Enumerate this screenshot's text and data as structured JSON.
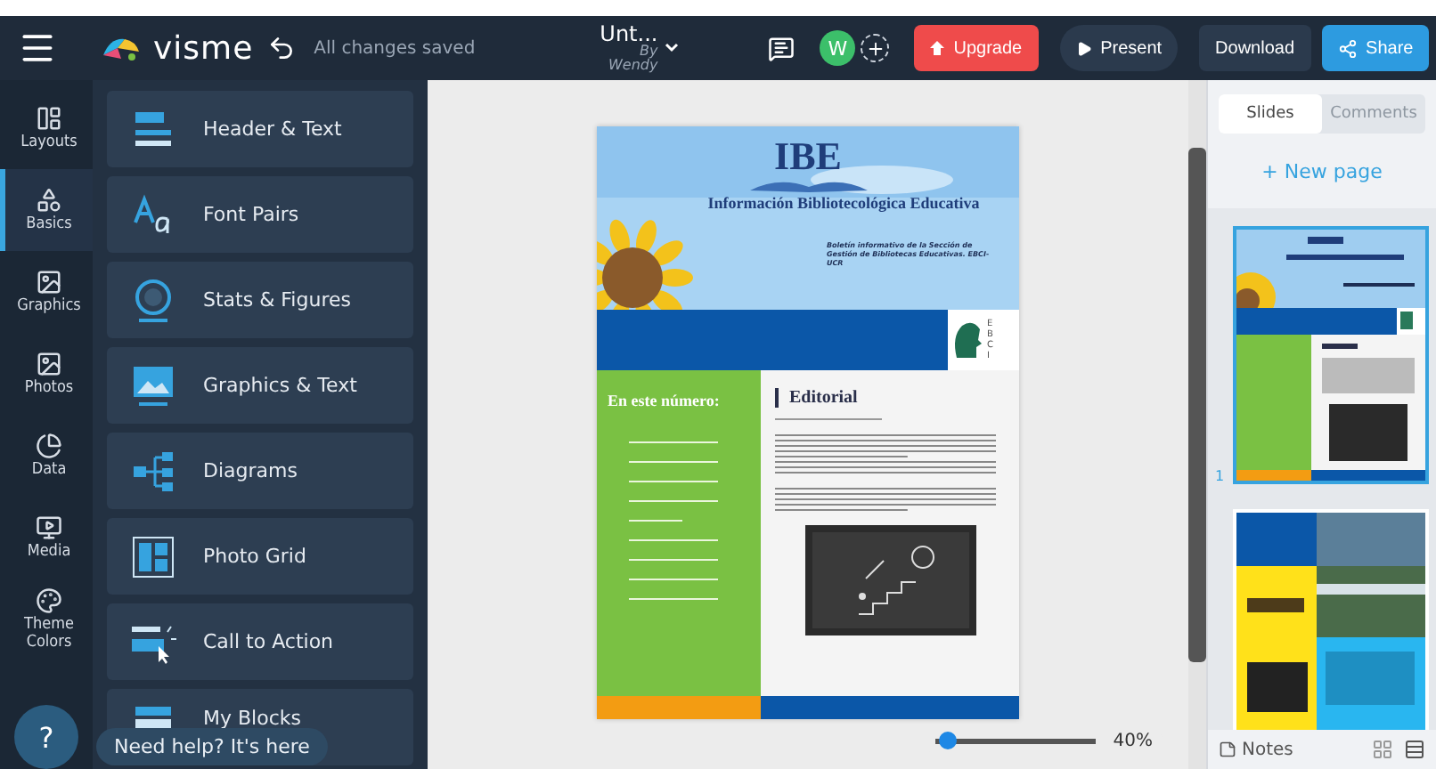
{
  "topbar": {
    "logo": "visme",
    "save_status": "All changes saved",
    "doc_title": "Unt...",
    "author_by": "By",
    "author_name": "Wendy",
    "avatar": "W",
    "upgrade": "Upgrade",
    "present": "Present",
    "download": "Download",
    "share": "Share"
  },
  "rail": [
    {
      "label": "Layouts",
      "kind": "layouts",
      "selected": false
    },
    {
      "label": "Basics",
      "kind": "basics",
      "selected": true
    },
    {
      "label": "Graphics",
      "kind": "graphics",
      "selected": false
    },
    {
      "label": "Photos",
      "kind": "photos",
      "selected": false
    },
    {
      "label": "Data",
      "kind": "data",
      "selected": false
    },
    {
      "label": "Media",
      "kind": "media",
      "selected": false
    },
    {
      "label": "Theme Colors",
      "kind": "colors",
      "selected": false
    }
  ],
  "blocks": [
    {
      "label": "Header & Text",
      "kind": "header"
    },
    {
      "label": "Font Pairs",
      "kind": "fonts"
    },
    {
      "label": "Stats & Figures",
      "kind": "stats"
    },
    {
      "label": "Graphics & Text",
      "kind": "graphics"
    },
    {
      "label": "Diagrams",
      "kind": "diagram"
    },
    {
      "label": "Photo Grid",
      "kind": "grid"
    },
    {
      "label": "Call to Action",
      "kind": "cta"
    },
    {
      "label": "My Blocks",
      "kind": "myblocks"
    }
  ],
  "help": {
    "icon": "?",
    "text": "Need help? It's here"
  },
  "document": {
    "masthead": "IBE",
    "title": "Información Bibliotecológica Educativa",
    "subtitle": "Boletín informativo de la Sección de Gestión de Bibliotecas Educativas. EBCI-UCR",
    "side_letters": [
      "E",
      "B",
      "C",
      "I"
    ],
    "toc_title": "En este número:",
    "article_title": "Editorial"
  },
  "zoom": {
    "level": 0.08,
    "reading": "40%"
  },
  "right_panel": {
    "tabs": [
      {
        "label": "Slides",
        "selected": true
      },
      {
        "label": "Comments",
        "selected": false
      }
    ],
    "new_page": "+ New page",
    "slides": [
      {
        "number": "1",
        "kind": "newsletter",
        "selected": true
      },
      {
        "kind": "brochure",
        "selected": false
      }
    ],
    "notes": "Notes"
  }
}
